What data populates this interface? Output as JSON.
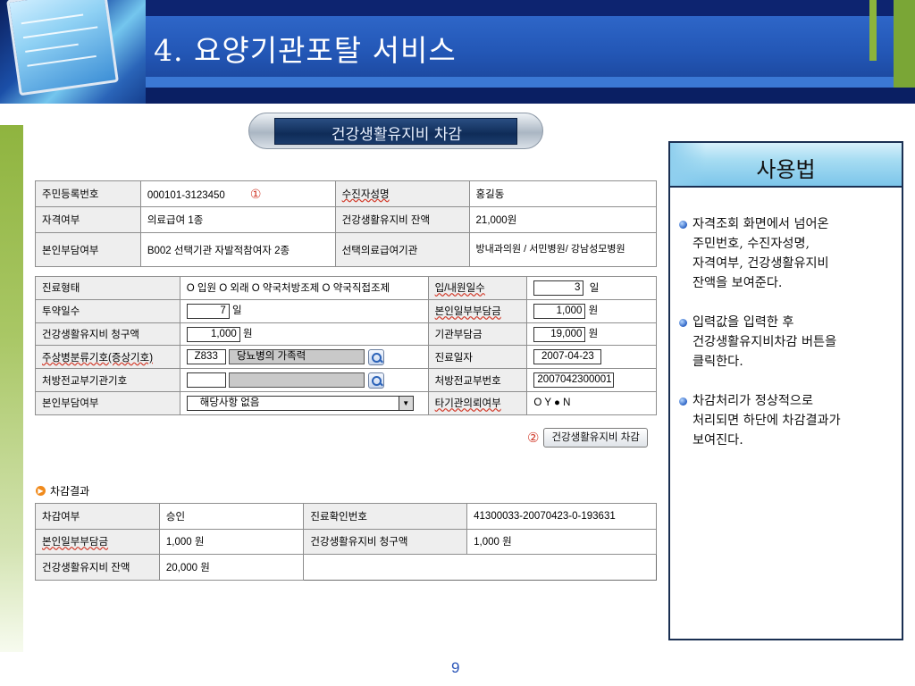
{
  "slide": {
    "title": "4. 요양기관포탈 서비스",
    "page_number": "9"
  },
  "pill_title": "건강생활유지비 차감",
  "form1": {
    "rows": [
      [
        "주민등록번호",
        "000101-3123450",
        "수진자성명",
        "홍길동"
      ],
      [
        "자격여부",
        "의료급여 1종",
        "건강생활유지비 잔액",
        "21,000원"
      ],
      [
        "본인부담여부",
        "B002  선택기관 자발적참여자 2종",
        "선택의료급여기관",
        "방내과의원 / 서민병원/ 강남성모병원"
      ]
    ],
    "step1_marker": "①"
  },
  "form2": {
    "treatment_type_label": "진료형태",
    "treatment_type_options": "O 입원  O 외래 O 약국처방조제 O 약국직접조제",
    "visit_days_label": "입/내원일수",
    "visit_days_value": "3",
    "day_unit": "일",
    "dose_days_label": "투약일수",
    "dose_days_value": "7",
    "claim_label": "건강생활유지비 청구액",
    "claim_value": "1,000",
    "won_unit": "원",
    "self_copay_label": "본인일부부담금",
    "self_copay_value": "1,000",
    "institution_burden_label": "기관부담금",
    "institution_burden_value": "19,000",
    "disease_code_label": "주상병분류기호(증상기호)",
    "disease_code_value": "Z833",
    "disease_name_value": "당뇨병의 가족력",
    "treatment_date_label": "진료일자",
    "treatment_date_value": "2007-04-23",
    "prescribing_inst_label": "처방전교부기관기호",
    "prescription_no_label": "처방전교부번호",
    "prescription_no_value": "2007042300001",
    "self_burden_label": "본인부담여부",
    "self_burden_value": "해당사항 없음",
    "other_inst_label": "타기관의뢰여부",
    "other_inst_value": "O  Y ● N"
  },
  "step2": {
    "marker": "②",
    "button_label": "건강생활유지비 차감"
  },
  "result": {
    "heading": "차감결과",
    "rows": [
      [
        "차감여부",
        "승인",
        "진료확인번호",
        "41300033-20070423-0-193631"
      ],
      [
        "본인일부부담금",
        "1,000 원",
        "건강생활유지비 청구액",
        "1,000 원"
      ],
      [
        "건강생활유지비 잔액",
        "20,000 원",
        "",
        ""
      ]
    ]
  },
  "panel": {
    "title": "사용법",
    "items": [
      "자격조회 화면에서 넘어온\n주민번호, 수진자성명,\n자격여부, 건강생활유지비\n잔액을 보여준다.",
      "입력값을 입력한 후\n건강생활유지비차감 버튼을\n클릭한다.",
      "차감처리가 정상적으로\n처리되면 하단에 차감결과가\n보여진다."
    ]
  }
}
